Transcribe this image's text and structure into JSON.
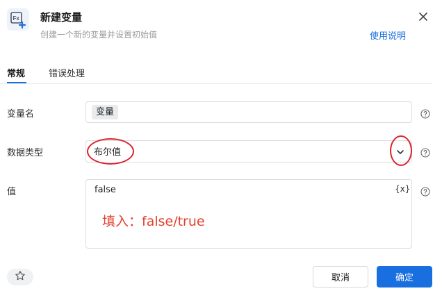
{
  "header": {
    "title": "新建变量",
    "subtitle": "创建一个新的变量并设置初始值",
    "help_link": "使用说明"
  },
  "tabs": [
    {
      "label": "常规",
      "active": true
    },
    {
      "label": "错误处理",
      "active": false
    }
  ],
  "fields": {
    "name": {
      "label": "变量名",
      "value": "变量"
    },
    "type": {
      "label": "数据类型",
      "value": "布尔值"
    },
    "value": {
      "label": "值",
      "value": "false",
      "fx_toggle": "{x}"
    }
  },
  "annotation": "填入：false/true",
  "footer": {
    "cancel_label": "取消",
    "confirm_label": "确定"
  },
  "colors": {
    "accent": "#1a6fe0",
    "annotation_red": "#d9232e"
  }
}
